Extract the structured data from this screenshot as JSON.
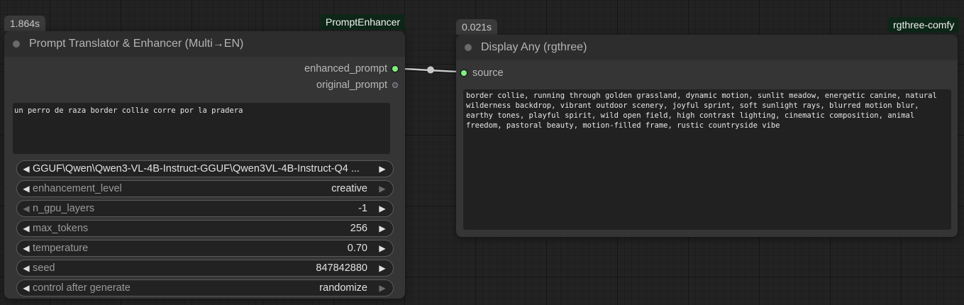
{
  "node1": {
    "time_badge": "1.864s",
    "type_tag": "PromptEnhancer",
    "title": "Prompt Translator & Enhancer (Multi→EN)",
    "outputs": [
      "enhanced_prompt",
      "original_prompt"
    ],
    "input_text": "un perro de raza border collie corre por la pradera",
    "model_value": "GGUF\\Qwen\\Qwen3-VL-4B-Instruct-GGUF\\Qwen3VL-4B-Instruct-Q4 ...",
    "widgets": [
      {
        "label": "enhancement_level",
        "value": "creative"
      },
      {
        "label": "n_gpu_layers",
        "value": "-1"
      },
      {
        "label": "max_tokens",
        "value": "256"
      },
      {
        "label": "temperature",
        "value": "0.70"
      },
      {
        "label": "seed",
        "value": "847842880"
      },
      {
        "label": "control after generate",
        "value": "randomize"
      }
    ]
  },
  "node2": {
    "time_badge": "0.021s",
    "type_tag": "rgthree-comfy",
    "title": "Display Any (rgthree)",
    "input_label": "source",
    "output_text": "border collie, running through golden grassland, dynamic motion, sunlit meadow, energetic canine, natural wilderness backdrop, vibrant outdoor scenery, joyful sprint, soft sunlight rays, blurred motion blur, earthy tones, playful spirit, wild open field, high contrast lighting, cinematic composition, animal freedom, pastoral beauty, motion-filled frame, rustic countryside vibe"
  },
  "colors": {
    "canvas": "#222222",
    "node_body": "#353535",
    "node_header": "#2d2d2d",
    "socket_active": "#7df07d",
    "tag_bg": "#0d2617"
  }
}
